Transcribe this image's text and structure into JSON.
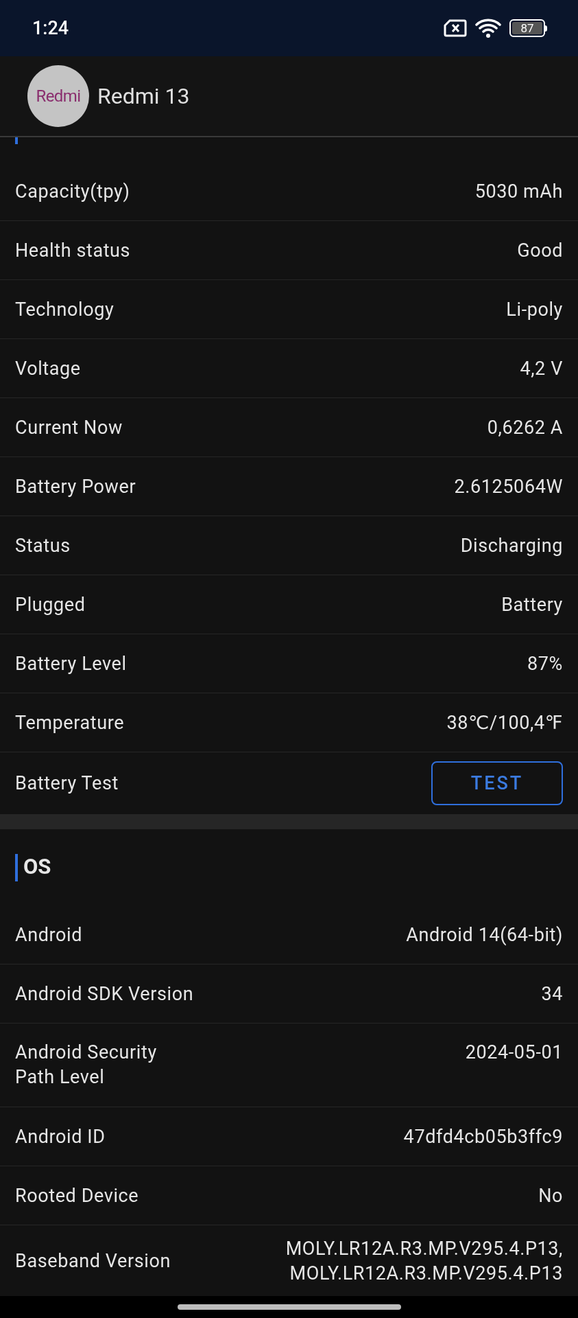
{
  "status_bar": {
    "time": "1:24",
    "battery": "87"
  },
  "header": {
    "logo": "Redmi",
    "title": "Redmi 13"
  },
  "sections": [
    {
      "rows": [
        {
          "kind": "text",
          "label": "Capacity(tpy)",
          "value": "5030 mAh"
        },
        {
          "kind": "text",
          "label": "Health status",
          "value": "Good"
        },
        {
          "kind": "text",
          "label": "Technology",
          "value": "Li-poly"
        },
        {
          "kind": "text",
          "label": "Voltage",
          "value": "4,2 V"
        },
        {
          "kind": "text",
          "label": "Current Now",
          "value": "0,6262 A"
        },
        {
          "kind": "text",
          "label": "Battery Power",
          "value": "2.6125064W"
        },
        {
          "kind": "text",
          "label": "Status",
          "value": "Discharging"
        },
        {
          "kind": "text",
          "label": "Plugged",
          "value": "Battery"
        },
        {
          "kind": "text",
          "label": "Battery Level",
          "value": "87%"
        },
        {
          "kind": "text",
          "label": "Temperature",
          "value": "38℃/100,4℉"
        },
        {
          "kind": "button",
          "label": "Battery Test",
          "value": "TEST"
        }
      ]
    },
    {
      "title": "OS",
      "rows": [
        {
          "kind": "text",
          "label": "Android",
          "value": "Android 14(64-bit)"
        },
        {
          "kind": "text",
          "label": "Android SDK Version",
          "value": "34"
        },
        {
          "kind": "text",
          "label": "Android Security\nPath Level",
          "value": "2024-05-01"
        },
        {
          "kind": "text",
          "label": "Android ID",
          "value": "47dfd4cb05b3ffc9"
        },
        {
          "kind": "text",
          "label": "Rooted Device",
          "value": "No"
        },
        {
          "kind": "text",
          "label": "Baseband Version",
          "value": "MOLY.LR12A.R3.MP.V295.4.P13,\nMOLY.LR12A.R3.MP.V295.4.P13"
        }
      ]
    }
  ]
}
